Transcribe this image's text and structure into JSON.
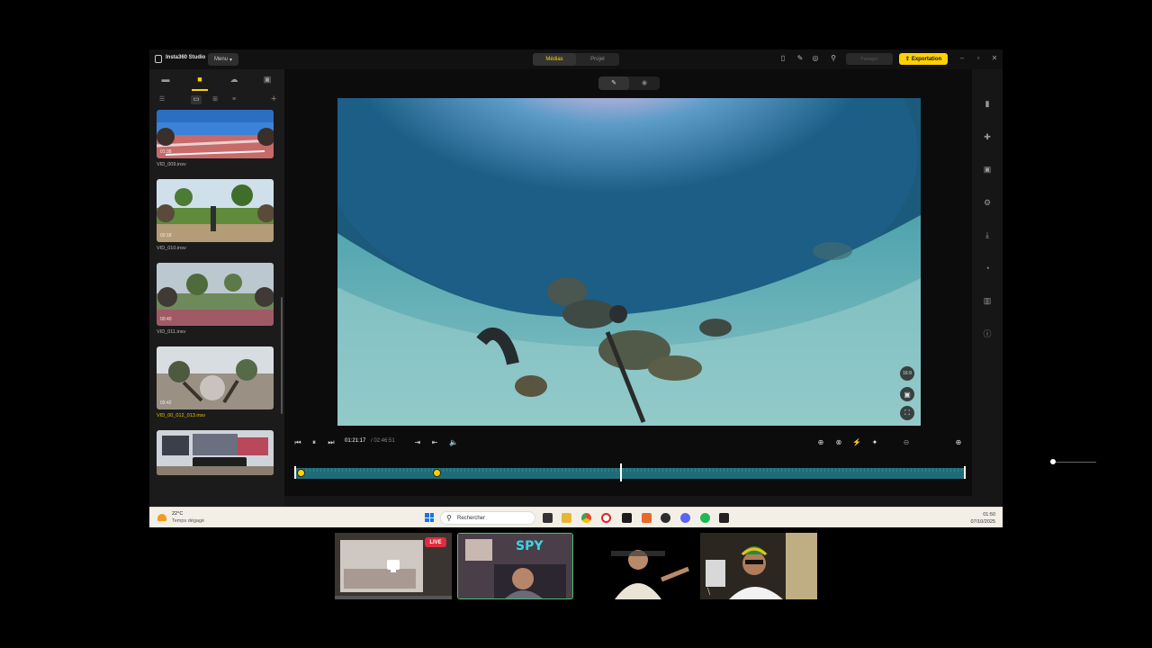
{
  "app": {
    "title": "Insta360 Studio",
    "menu_label": "Menu",
    "tabs": [
      {
        "label": "Médias",
        "active": true
      },
      {
        "label": "Projet",
        "active": false
      }
    ],
    "share_label": "Partager",
    "export_label": "Exportation",
    "accent_color": "#ffd200"
  },
  "sidebar": {
    "clips": [
      {
        "name": "VID_009.insv",
        "duration": "01:38"
      },
      {
        "name": "VID_010.insv",
        "duration": "00:18"
      },
      {
        "name": "VID_011.insv",
        "duration": "00:40"
      },
      {
        "name": "VID_00_012_013.insv",
        "duration": "03:42",
        "selected": true
      },
      {
        "name": "",
        "duration": ""
      }
    ]
  },
  "player": {
    "current_time": "01:21:17",
    "total_time": "/ 02:46:51",
    "aspect_label": "16:9",
    "timeline": {
      "playhead_fraction": 0.487,
      "markers": [
        0.009,
        0.212
      ]
    }
  },
  "taskbar": {
    "temperature": "22°C",
    "weather": "Temps dégagé",
    "search_placeholder": "Rechercher",
    "time": "01:50",
    "date": "07/10/2025"
  },
  "stream": {
    "live_label": "LIVE"
  }
}
